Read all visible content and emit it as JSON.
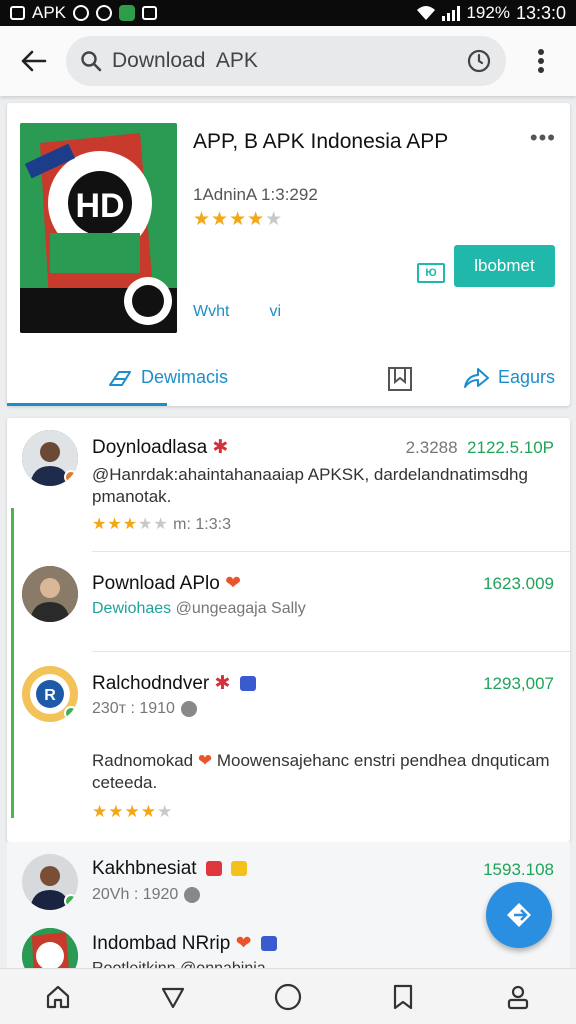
{
  "status_bar": {
    "carrier_label": "APK",
    "battery": "192%",
    "time": "13:3:0"
  },
  "search": {
    "query": "Download  APK"
  },
  "app": {
    "title": "APP, B APK Indonesia APP",
    "meta": "1AdninΑ 1:3:292",
    "rating_stars": 4,
    "install_label": "lbobmet",
    "badge_label": "Ю",
    "links": [
      "Wvht",
      "vi"
    ],
    "icon_text": "HD",
    "actions": {
      "download_label": "Dewimacis",
      "share_label": "Eagurs"
    }
  },
  "reviews": [
    {
      "name": "Doynloadlasa",
      "num_gray": "2.3288",
      "num_green": "2122.5.10P",
      "text": "@Hanrdak:ahaintahanaaiap APKSK, dardelandnatimsdhg pmanotak.",
      "rating_stars": 3,
      "meta": "m:  1:3:3"
    },
    {
      "name": "Pownload APlo",
      "num_green": "1623.009",
      "sub_blue": "Dewiohaes",
      "sub_gray": "@ungeagaja Sally"
    },
    {
      "name": "Ralchodndver",
      "num_green": "1293,007",
      "meta": "230т :  1910",
      "text": "Radnomokad",
      "text2": "Moowensajehanc enstri pendhea dnquticam ceteeda.",
      "rating_stars": 4
    },
    {
      "name": "Kakhbnesiat",
      "num_green": "1593.108",
      "meta": "20Vh :  1920"
    },
    {
      "name": "Indombad NRrip",
      "meta": "Rootleitkinn @onnabinia"
    }
  ],
  "colors": {
    "accent": "#1d8ec9",
    "install": "#1fb8aa",
    "positive": "#22a35a",
    "star": "#f3a712",
    "fab": "#2a8fe0"
  }
}
